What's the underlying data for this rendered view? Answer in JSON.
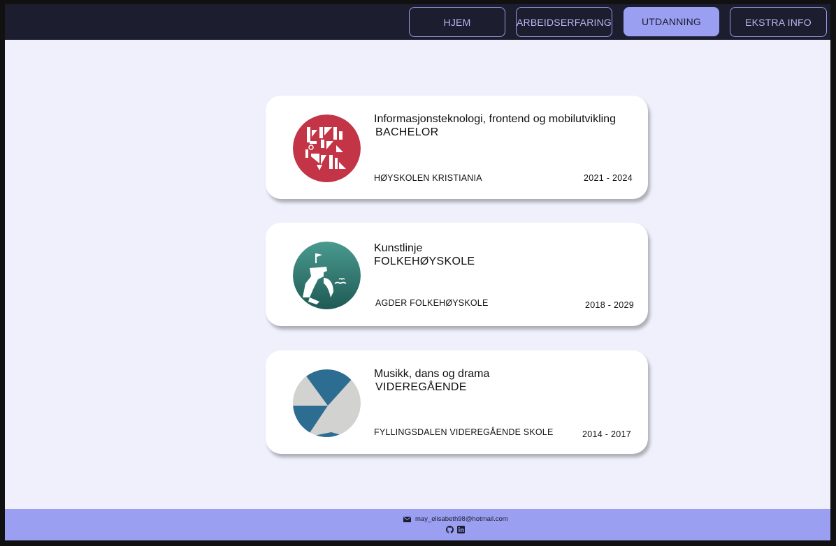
{
  "nav": {
    "items": [
      {
        "label": "HJEM",
        "active": false
      },
      {
        "label": "ARBEIDSERFARING",
        "active": false
      },
      {
        "label": "UTDANNING",
        "active": true
      },
      {
        "label": "EKSTRA INFO",
        "active": false
      }
    ]
  },
  "education": [
    {
      "study": "Informasjonsteknologi, frontend og mobilutvikling",
      "degree": "BACHELOR",
      "school": "HØYSKOLEN KRISTIANIA",
      "years": "2021 - 2024",
      "logo_icon": "kristiania-logo-icon"
    },
    {
      "study": "Kunstlinje",
      "degree": "FOLKEHØYSKOLE",
      "school": "AGDER FOLKEHØYSKOLE",
      "years": "2018 - 2029",
      "logo_icon": "agder-folkehoyskole-logo-icon"
    },
    {
      "study": "Musikk, dans og drama",
      "degree": "VIDEREGÅENDE",
      "school": "FYLLINGSDALEN VIDEREGÅENDE SKOLE",
      "years": "2014 - 2017",
      "logo_icon": "fyllingsdalen-logo-icon"
    }
  ],
  "footer": {
    "email": "may_elisabeth98@hotmail.com",
    "icons": [
      "mail-icon",
      "github-icon",
      "linkedin-icon"
    ]
  },
  "colors": {
    "background": "#1c1d2e",
    "accent": "#9a9ff1",
    "content_bg": "#f0f0fc",
    "kristiania_red": "#c23446",
    "agder_teal": "#3f8c83",
    "fyllingsdalen_blue": "#2e6d92"
  }
}
